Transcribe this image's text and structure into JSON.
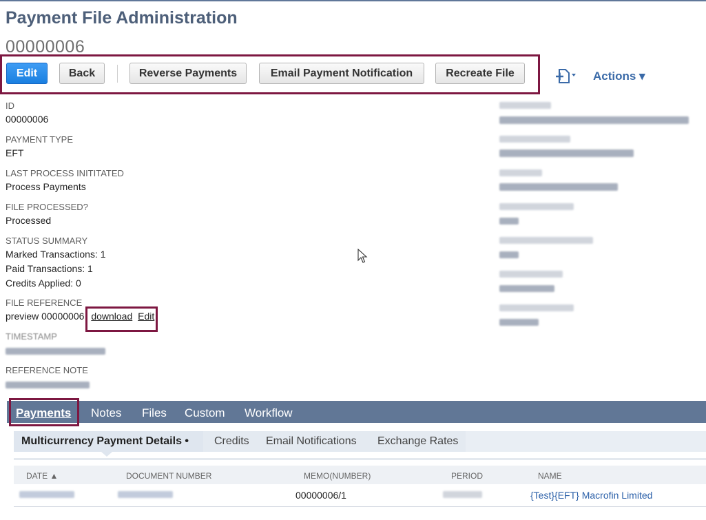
{
  "header": {
    "title": "Payment File Administration",
    "record_id": "00000006"
  },
  "toolbar": {
    "edit": "Edit",
    "back": "Back",
    "reverse": "Reverse Payments",
    "email": "Email Payment Notification",
    "recreate": "Recreate File",
    "actions": "Actions ▾",
    "new_icon_caret": "▾"
  },
  "fields": {
    "id": {
      "label": "ID",
      "value": "00000006"
    },
    "payment_type": {
      "label": "PAYMENT TYPE",
      "value": "EFT"
    },
    "last_process": {
      "label": "LAST PROCESS INITITATED",
      "value": "Process Payments"
    },
    "file_processed": {
      "label": "FILE PROCESSED?",
      "value": "Processed"
    },
    "status_summary": {
      "label": "STATUS SUMMARY",
      "lines": [
        "Marked Transactions: 1",
        "Paid Transactions: 1",
        "Credits Applied: 0"
      ]
    },
    "file_reference": {
      "label": "FILE REFERENCE",
      "preview": "preview 00000006",
      "download": "download",
      "edit": "Edit"
    },
    "timestamp": {
      "label": "TIMESTAMP"
    },
    "reference_note": {
      "label": "REFERENCE NOTE"
    }
  },
  "tabs": [
    {
      "label": "Payments",
      "active": true
    },
    {
      "label": "Notes"
    },
    {
      "label": "Files"
    },
    {
      "label": "Custom"
    },
    {
      "label": "Workflow"
    }
  ],
  "subtabs": [
    {
      "label": "Multicurrency Payment Details •",
      "active": true
    },
    {
      "label": "Credits"
    },
    {
      "label": "Email Notifications"
    },
    {
      "label": "Exchange Rates"
    }
  ],
  "grid": {
    "columns": [
      "DATE ▲",
      "DOCUMENT NUMBER",
      "MEMO(NUMBER)",
      "PERIOD",
      "NAME"
    ],
    "rows": [
      {
        "memo": "00000006/1",
        "name": "{Test}{EFT} Macrofin Limited"
      }
    ]
  },
  "colors": {
    "accent": "#7d1741",
    "tabbar": "#617796",
    "primary_button": "#1a7fe0",
    "link": "#2a5fa8"
  }
}
